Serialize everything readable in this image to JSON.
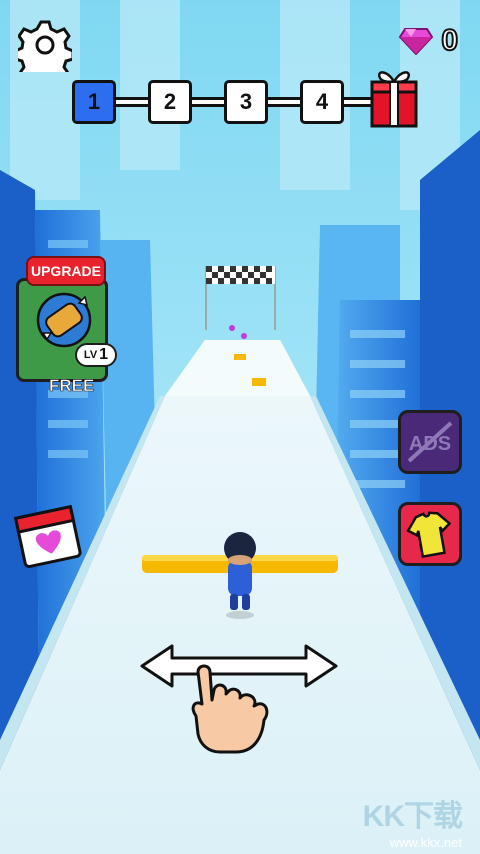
{
  "hud": {
    "gem_count": "0",
    "levels": [
      "1",
      "2",
      "3",
      "4"
    ],
    "current_level": "1"
  },
  "upgrade": {
    "tag": "UPGRADE",
    "lv_prefix": "LV",
    "lv_value": "1",
    "price": "FREE"
  },
  "side_buttons": {
    "no_ads": "ADS"
  },
  "watermark": {
    "brand": "KK下载",
    "site": "www.kkx.net"
  },
  "colors": {
    "sky": "#9fe3f7",
    "road": "#e8f4f8",
    "bar": "#f6b800",
    "level_active": "#2d6df0",
    "gem": "#e64ad8",
    "gift": "#e3132a"
  },
  "icons": [
    "gear-icon",
    "gem-icon",
    "gift-icon",
    "roller-icon",
    "no-ads-icon",
    "shirt-icon",
    "calendar-heart-icon",
    "swipe-hand-icon",
    "double-arrow-icon"
  ]
}
